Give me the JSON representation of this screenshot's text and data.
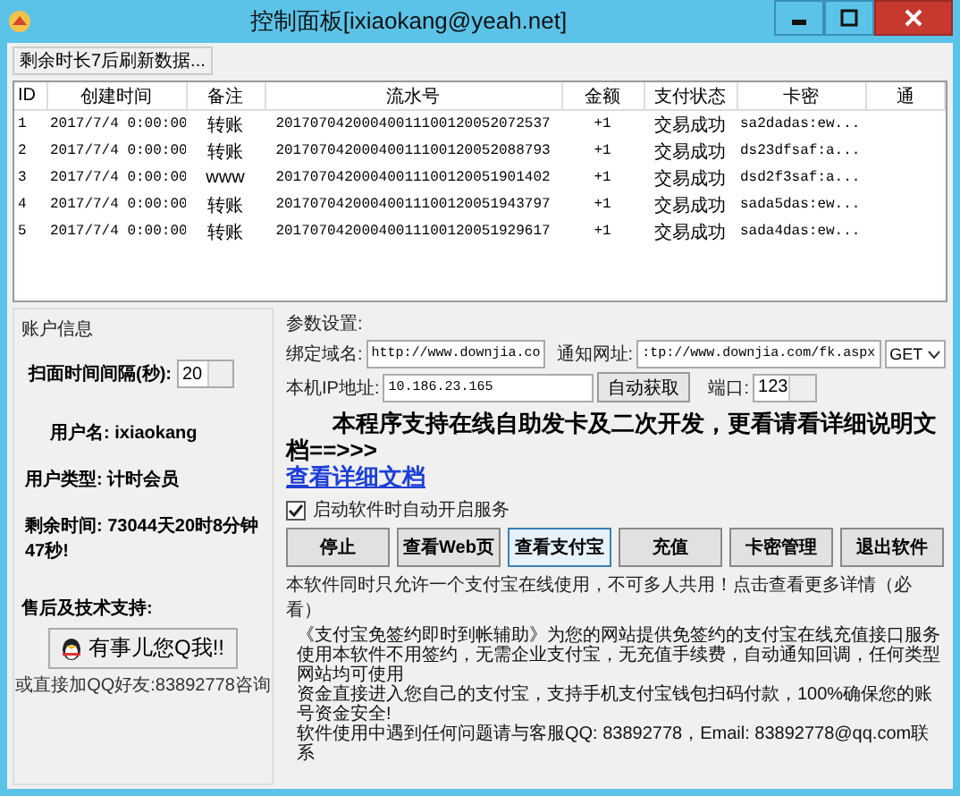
{
  "window": {
    "title": "控制面板[ixiaokang@yeah.net]"
  },
  "status": "剩余时长7后刷新数据...",
  "table": {
    "columns": [
      "ID",
      "创建时间",
      "备注",
      "流水号",
      "金额",
      "支付状态",
      "卡密",
      "通"
    ],
    "rows": [
      [
        "1",
        "2017/7/4 0:00:00",
        "转账",
        "20170704200040011100120052072537",
        "+1",
        "交易成功",
        "sa2dadas:ew..."
      ],
      [
        "2",
        "2017/7/4 0:00:00",
        "转账",
        "20170704200040011100120052088793",
        "+1",
        "交易成功",
        "ds23dfsaf:a..."
      ],
      [
        "3",
        "2017/7/4 0:00:00",
        "www",
        "20170704200040011100120051901402",
        "+1",
        "交易成功",
        "dsd2f3saf:a..."
      ],
      [
        "4",
        "2017/7/4 0:00:00",
        "转账",
        "20170704200040011100120051943797",
        "+1",
        "交易成功",
        "sada5das:ew..."
      ],
      [
        "5",
        "2017/7/4 0:00:00",
        "转账",
        "20170704200040011100120051929617",
        "+1",
        "交易成功",
        "sada4das:ew..."
      ]
    ]
  },
  "account": {
    "title": "账户信息",
    "interval_label": "扫面时间间隔(秒):",
    "interval_value": "20",
    "fields": [
      {
        "label": "用户名:",
        "value": "ixiaokang"
      },
      {
        "label": "用户类型:",
        "value": "计时会员"
      },
      {
        "label": "剩余时间:",
        "value": "73044天20时8分钟47秒!"
      }
    ],
    "support_label": "售后及技术支持:",
    "qq_button": "有事儿您Q我!!",
    "qq_note": "或直接加QQ好友:83892778咨询"
  },
  "settings": {
    "title": "参数设置:",
    "domain_label": "绑定域名:",
    "domain_value": "http://www.downjia.co",
    "notify_label": "通知网址:",
    "notify_value": ":tp://www.downjia.com/fk.aspx",
    "method": "GET",
    "ip_label": "本机IP地址:",
    "ip_value": "10.186.23.165",
    "auto_button": "自动获取",
    "port_label": "端口:",
    "port_value": "123",
    "headline": "本程序支持在线自助发卡及二次开发，更看请看详细说明文档==>>>",
    "doc_link": "查看详细文档",
    "autostart": {
      "label": "启动软件时自动开启服务",
      "checked": true
    },
    "buttons": [
      {
        "label": "停止",
        "selected": false
      },
      {
        "label": "查看Web页",
        "selected": false
      },
      {
        "label": "查看支付宝",
        "selected": true
      },
      {
        "label": "充值",
        "selected": false
      },
      {
        "label": "卡密管理",
        "selected": false
      },
      {
        "label": "退出软件",
        "selected": false
      }
    ],
    "notice": "本软件同时只允许一个支付宝在线使用，不可多人共用！点击查看更多详情（必看）",
    "description": [
      "《支付宝免签约即时到帐辅助》为您的网站提供免签约的支付宝在线充值接口服务",
      "使用本软件不用签约，无需企业支付宝，无充值手续费，自动通知回调，任何类型网站均可使用",
      "资金直接进入您自己的支付宝，支持手机支付宝钱包扫码付款，100%确保您的账号资金安全!",
      "软件使用中遇到任何问题请与客服QQ: 83892778，Email: 83892778@qq.com联系"
    ]
  }
}
